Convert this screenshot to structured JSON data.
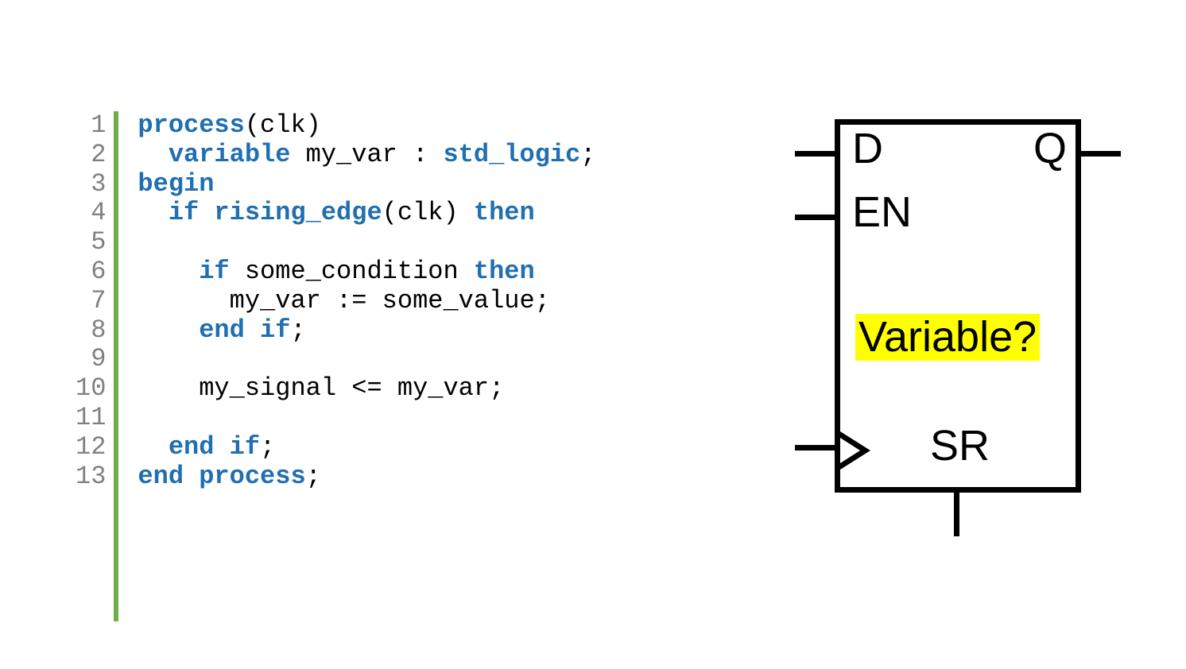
{
  "code": {
    "line_numbers": [
      "1",
      "2",
      "3",
      "4",
      "5",
      "6",
      "7",
      "8",
      "9",
      "10",
      "11",
      "12",
      "13"
    ],
    "lines": {
      "l1": {
        "kw1": "process",
        "p1": "(clk)"
      },
      "l2": {
        "indent": "  ",
        "kw1": "variable",
        "id1": " my_var : ",
        "kw2": "std_logic",
        "p1": ";"
      },
      "l3": {
        "kw1": "begin"
      },
      "l4": {
        "indent": "  ",
        "kw1": "if",
        "sp": " ",
        "kw2": "rising_edge",
        "p1": "(clk) ",
        "kw3": "then"
      },
      "l5": {
        "blank": ""
      },
      "l6": {
        "indent": "    ",
        "kw1": "if",
        "id1": " some_condition ",
        "kw2": "then"
      },
      "l7": {
        "indent": "      ",
        "id1": "my_var := some_value;"
      },
      "l8": {
        "indent": "    ",
        "kw1": "end",
        "sp": " ",
        "kw2": "if",
        "p1": ";"
      },
      "l9": {
        "blank": ""
      },
      "l10": {
        "indent": "    ",
        "id1": "my_signal <= my_var;"
      },
      "l11": {
        "blank": ""
      },
      "l12": {
        "indent": "  ",
        "kw1": "end",
        "sp": " ",
        "kw2": "if",
        "p1": ";"
      },
      "l13": {
        "kw1": "end",
        "sp": " ",
        "kw2": "process",
        "p1": ";"
      }
    }
  },
  "ff": {
    "d": "D",
    "q": "Q",
    "en": "EN",
    "sr": "SR",
    "variable": "Variable?"
  }
}
